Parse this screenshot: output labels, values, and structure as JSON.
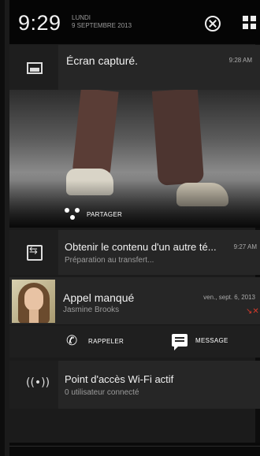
{
  "status": {
    "time": "9:29",
    "day": "LUNDI",
    "date": "9 SEPTEMBRE 2013"
  },
  "notifications": {
    "screenshot": {
      "icon": "image-icon",
      "title": "Écran capturé.",
      "time": "9:28 AM",
      "action_label": "PARTAGER",
      "action_icon": "share-icon"
    },
    "transfer": {
      "icon": "transfer-icon",
      "title": "Obtenir le contenu d'un autre té...",
      "subtitle": "Préparation au transfert...",
      "time": "9:27 AM"
    },
    "missed_call": {
      "title": "Appel manqué",
      "contact": "Jasmine Brooks",
      "time": "ven., sept. 6, 2013",
      "missed_icon_color": "#d73b2c",
      "actions": [
        {
          "label": "RAPPELER",
          "icon": "phone-icon"
        },
        {
          "label": "MESSAGE",
          "icon": "message-icon"
        }
      ]
    },
    "wifi_hotspot": {
      "icon": "wifi-hotspot-icon",
      "title": "Point d'accès Wi-Fi actif",
      "subtitle": "0 utilisateur connecté"
    }
  }
}
